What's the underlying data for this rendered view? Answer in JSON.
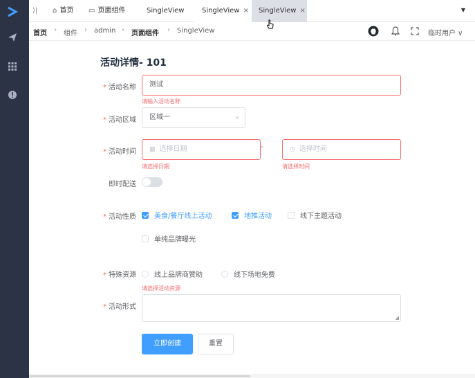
{
  "sidebar": {
    "icons": [
      "logo-chevron-icon",
      "send-icon",
      "grid-icon",
      "info-icon"
    ]
  },
  "tabs": [
    {
      "label": "首页",
      "icon": "home-icon"
    },
    {
      "label": "页面组件",
      "icon": "layout-icon"
    },
    {
      "label": "SingleView"
    },
    {
      "label": "SingleView",
      "closable": true,
      "active": true
    },
    {
      "label": "SingleView",
      "closable": true,
      "hover": true
    }
  ],
  "tab_sep": "⟩|",
  "tab_more": "▼",
  "close_glyph": "×",
  "breadcrumb": [
    "首页",
    "组件",
    "admin",
    "页面组件",
    "SingleView"
  ],
  "header": {
    "user": "临时用户 ∨"
  },
  "form": {
    "title": "活动详情- 101",
    "req_mark": "*",
    "name": {
      "label": "活动名称",
      "value": "测试",
      "error": "请输入活动名称"
    },
    "region": {
      "label": "活动区域",
      "value": "区域一"
    },
    "time": {
      "label": "活动时间",
      "date_placeholder": "选择日期",
      "time_placeholder": "选择时间",
      "dash": "-",
      "date_error": "请选择日期",
      "time_error": "请选择时间"
    },
    "delivery": {
      "label": "即时配送",
      "on": false
    },
    "type": {
      "label": "活动性质",
      "options": [
        {
          "label": "美食/餐厅线上活动",
          "checked": true
        },
        {
          "label": "地推活动",
          "checked": true
        },
        {
          "label": "线下主题活动",
          "checked": false
        },
        {
          "label": "单纯品牌曝光",
          "checked": false
        }
      ]
    },
    "resource": {
      "label": "特殊资源",
      "options": [
        "线上品牌商赞助",
        "线下场地免费"
      ],
      "error": "请选择活动资源"
    },
    "desc": {
      "label": "活动形式"
    },
    "submit": "立即创建",
    "reset": "重置"
  },
  "colors": {
    "sidebar": "#2b3344",
    "primary": "#409eff",
    "error": "#f56c6c"
  }
}
